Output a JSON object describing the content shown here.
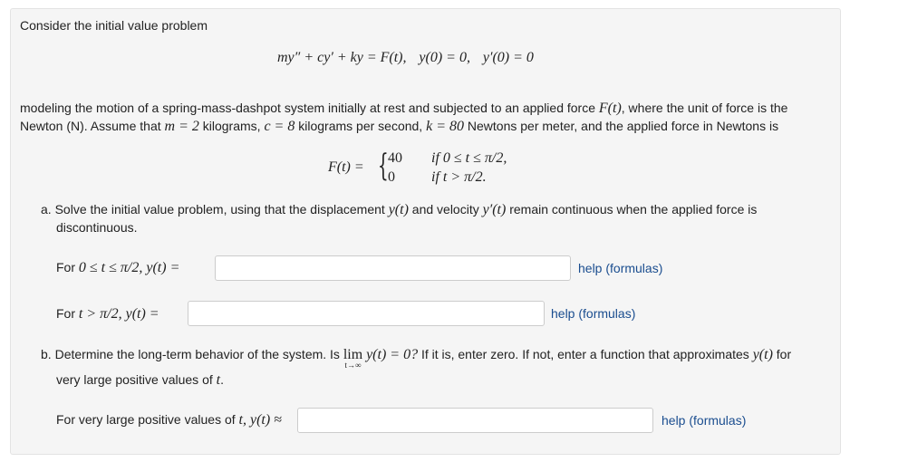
{
  "intro": "Consider the initial value problem",
  "ivp": {
    "lhs": "my″ + cy′ + ky = F(t),",
    "ic1": "y(0) = 0,",
    "ic2": "y′(0) = 0"
  },
  "description": {
    "line1_a": "modeling the motion of a spring-mass-dashpot system initially at rest and subjected to an applied force ",
    "line1_F": "F(t)",
    "line1_b": ", where the unit of force is the",
    "line2_a": "Newton (N). Assume that ",
    "m_eq": "m = 2",
    "line2_b": " kilograms, ",
    "c_eq": "c = 8",
    "line2_c": " kilograms per second, ",
    "k_eq": "k = 80",
    "line2_d": " Newtons per meter, and the applied force in Newtons is"
  },
  "piecewise": {
    "lhs": "F(t) =",
    "case1_value": "40",
    "case1_cond": "if 0 ≤ t ≤ π/2,",
    "case2_value": "0",
    "case2_cond": "if t > π/2."
  },
  "part_a": {
    "label": "a.",
    "text_1": "Solve the initial value problem, using that the displacement ",
    "y_t": "y(t)",
    "text_2": " and velocity ",
    "yp_t": "y′(t)",
    "text_3": " remain continuous when the applied force is",
    "text_4": "discontinuous.",
    "q1_prefix": "For ",
    "q1_math": "0 ≤ t ≤ π/2,  y(t) =",
    "q1_value": "",
    "q2_prefix": "For ",
    "q2_math": "t > π/2,  y(t) =",
    "q2_value": ""
  },
  "part_b": {
    "label": "b.",
    "text_1": "Determine the long-term behavior of the system. Is ",
    "lim": "lim",
    "lim_sub": "t→∞",
    "lim_rest": "y(t) = 0?",
    "text_2": " If it is, enter zero. If not, enter a function that approximates ",
    "y_t": "y(t)",
    "text_3": " for",
    "text_4": "very large positive values of ",
    "t": "t",
    "q3_prefix": "For very large positive values of ",
    "q3_math": "t, y(t) ≈",
    "q3_value": ""
  },
  "help_label": "help (formulas)",
  "colors": {
    "link": "#1a4d8f",
    "panel_bg": "#f5f5f5",
    "input_border": "#cccccc"
  }
}
